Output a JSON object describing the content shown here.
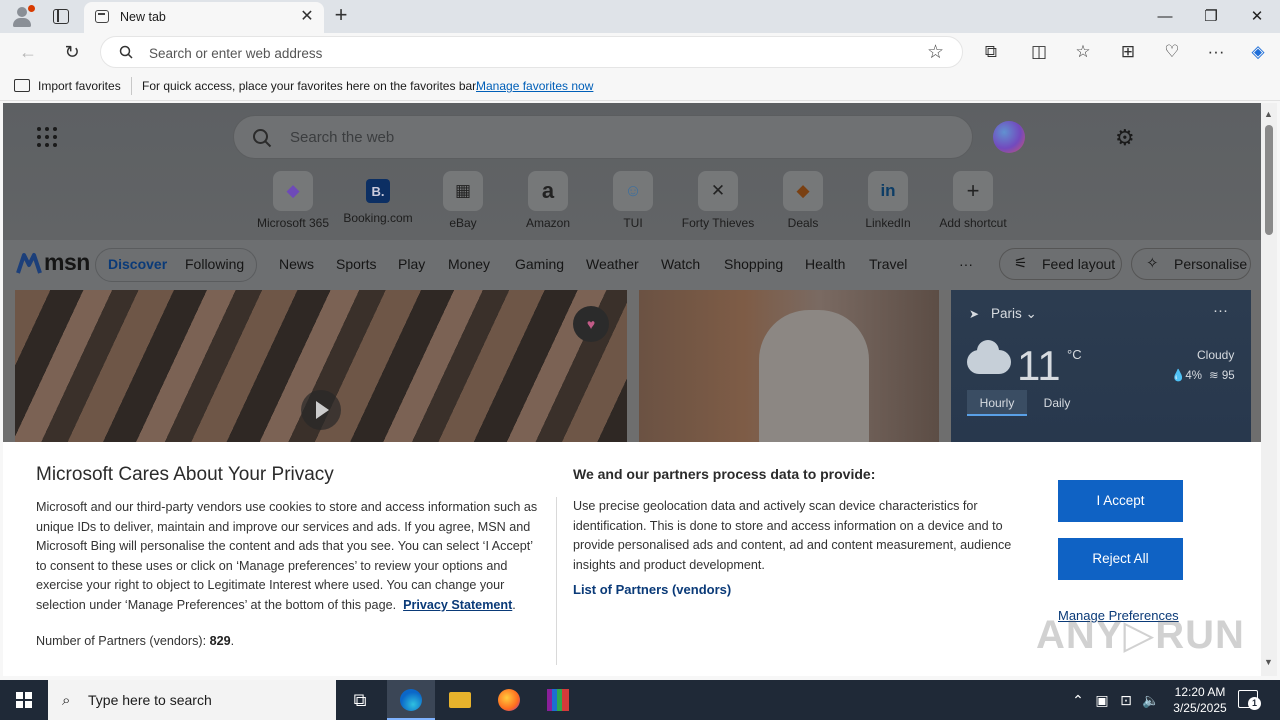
{
  "browser": {
    "tab": {
      "title": "New tab"
    },
    "omnibox": {
      "placeholder": "Search or enter web address"
    },
    "favorites_bar": {
      "import_label": "Import favorites",
      "message": "For quick access, place your favorites here on the favorites bar.",
      "manage_link": "Manage favorites now"
    }
  },
  "msn": {
    "search_placeholder": "Search the web",
    "shortcuts": [
      {
        "label": "Microsoft 365",
        "glyph": "◆",
        "icon": "microsoft-365-icon"
      },
      {
        "label": "Booking.com",
        "glyph": "B.",
        "icon": "booking-icon"
      },
      {
        "label": "eBay",
        "glyph": "▦",
        "icon": "ebay-icon"
      },
      {
        "label": "Amazon",
        "glyph": "a",
        "icon": "amazon-icon"
      },
      {
        "label": "TUI",
        "glyph": "☺",
        "icon": "tui-icon"
      },
      {
        "label": "Forty Thieves",
        "glyph": "✕",
        "icon": "forty-thieves-icon"
      },
      {
        "label": "Deals",
        "glyph": "◆",
        "icon": "deals-icon"
      },
      {
        "label": "LinkedIn",
        "glyph": "in",
        "icon": "linkedin-icon"
      },
      {
        "label": "Add shortcut",
        "glyph": "+",
        "icon": "plus-icon"
      }
    ],
    "logo": "msn",
    "nav": {
      "discover": "Discover",
      "following": "Following",
      "items": [
        "News",
        "Sports",
        "Play",
        "Money",
        "Gaming",
        "Weather",
        "Watch",
        "Shopping",
        "Health",
        "Travel"
      ],
      "more": "···",
      "feed_layout": "Feed layout",
      "personalise": "Personalise"
    },
    "weather": {
      "location": "Paris",
      "temp": "11",
      "unit": "°C",
      "condition": "Cloudy",
      "precip": "4%",
      "aqi": "95",
      "tabs": [
        "Hourly",
        "Daily"
      ]
    }
  },
  "privacy": {
    "title": "Microsoft Cares About Your Privacy",
    "body": "Microsoft and our third-party vendors use cookies to store and access information such as unique IDs to deliver, maintain and improve our services and ads. If you agree, MSN and Microsoft Bing will personalise the content and ads that you see. You can select ‘I Accept’ to consent to these uses or click on ‘Manage preferences’ to review your options and exercise your right to object to Legitimate Interest where used.  You can change your selection under ‘Manage Preferences’ at the bottom of this page.",
    "privacy_link": "Privacy Statement",
    "partners_label": "Number of Partners (vendors):",
    "partners_count": "829",
    "title2": "We and our partners process data to provide:",
    "body2": "Use precise geolocation data and actively scan device characteristics for identification. This is done to store and access information on a device and to provide personalised ads and content, ad and content measurement, audience insights and product development.",
    "partners_link": "List of Partners (vendors)",
    "accept": "I Accept",
    "reject": "Reject All",
    "manage": "Manage Preferences"
  },
  "taskbar": {
    "search_placeholder": "Type here to search",
    "time": "12:20 AM",
    "date": "3/25/2025",
    "notifications": "1"
  },
  "watermark": "ANY.RUN"
}
